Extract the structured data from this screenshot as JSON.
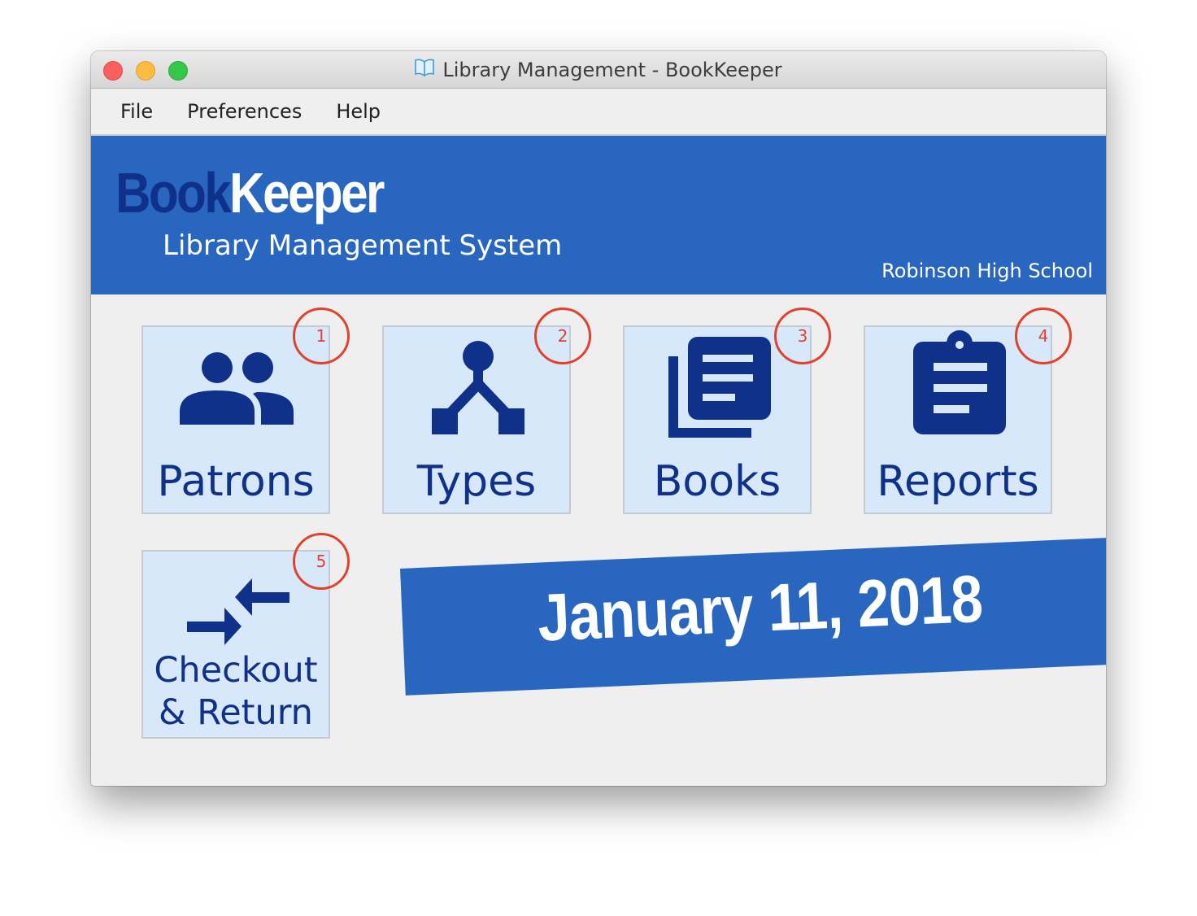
{
  "window": {
    "title": "Library Management - BookKeeper",
    "title_icon": "open-book-icon"
  },
  "menu": {
    "items": [
      {
        "label": "File"
      },
      {
        "label": "Preferences"
      },
      {
        "label": "Help"
      }
    ]
  },
  "header": {
    "logo_part1": "Book",
    "logo_part2": "Keeper",
    "subtitle": "Library Management System",
    "school": "Robinson High School"
  },
  "tiles": [
    {
      "label": "Patrons",
      "badge": "1",
      "icon": "people-icon"
    },
    {
      "label": "Types",
      "badge": "2",
      "icon": "type-tree-icon"
    },
    {
      "label": "Books",
      "badge": "3",
      "icon": "books-stack-icon"
    },
    {
      "label": "Reports",
      "badge": "4",
      "icon": "clipboard-icon"
    },
    {
      "label_line1": "Checkout",
      "label_line2": "& Return",
      "badge": "5",
      "icon": "exchange-arrows-icon"
    }
  ],
  "date": "January 11, 2018",
  "colors": {
    "brand_blue": "#2866c0",
    "dark_blue": "#10318a",
    "tile_bg": "#d8e8fb",
    "badge_red": "#e5402b"
  }
}
